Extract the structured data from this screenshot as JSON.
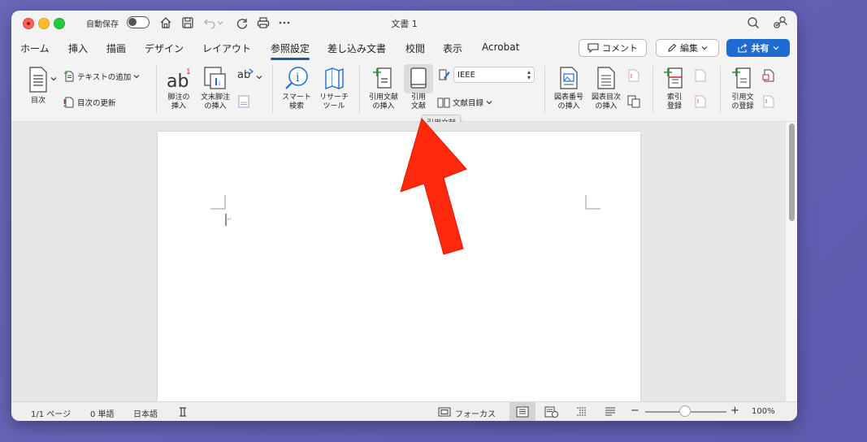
{
  "window": {
    "title": "文書 1",
    "autosave_label": "自動保存"
  },
  "tabs": [
    {
      "label": "ホーム"
    },
    {
      "label": "挿入"
    },
    {
      "label": "描画"
    },
    {
      "label": "デザイン"
    },
    {
      "label": "レイアウト"
    },
    {
      "label": "参照設定",
      "active": true
    },
    {
      "label": "差し込み文書"
    },
    {
      "label": "校閲"
    },
    {
      "label": "表示"
    },
    {
      "label": "Acrobat"
    }
  ],
  "actions": {
    "comment": "コメント",
    "edit": "編集",
    "share": "共有"
  },
  "ribbon": {
    "toc": "目次",
    "add_text": "テキストの追加",
    "update_toc": "目次の更新",
    "insert_footnote": "脚注の\n挿入",
    "insert_endnote": "文末脚注\nの挿入",
    "smart_lookup": "スマート\n検索",
    "researcher": "リサーチ\nツール",
    "insert_citation": "引用文献\nの挿入",
    "citation_sources": "引用\n文献",
    "style_value": "IEEE",
    "bibliography": "文献目録",
    "insert_caption": "図表番号\nの挿入",
    "insert_table_of_figures": "図表目次\nの挿入",
    "mark_entry": "索引\n登録",
    "mark_citation": "引用文\nの登録",
    "tooltip": "引用文献"
  },
  "statusbar": {
    "page": "1/1 ページ",
    "words": "0 単語",
    "language": "日本語",
    "focus": "フォーカス",
    "zoom": "100%",
    "minus": "−",
    "plus": "+"
  },
  "colors": {
    "accent": "#2b579a",
    "share_button": "#1f6cd1",
    "arrow": "#ff2a0e"
  }
}
